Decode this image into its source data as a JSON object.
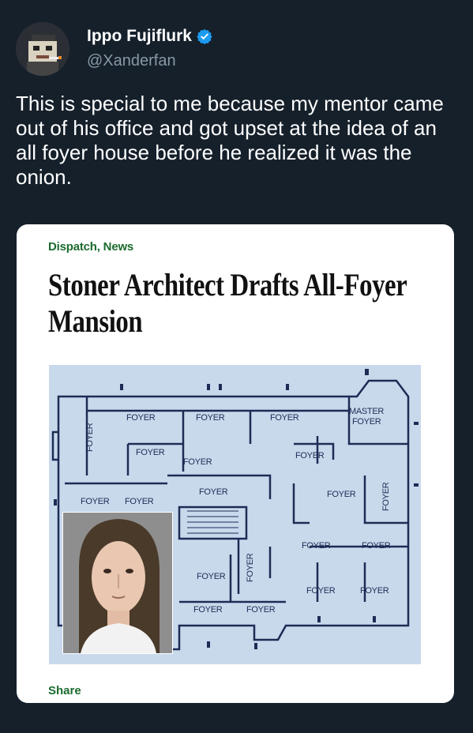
{
  "tweet": {
    "display_name": "Ippo Fujiflurk",
    "handle": "@Xanderfan",
    "text": "This is special to me because my mentor came out of his office and got upset at the idea of an all foyer house before he realized it was the onion.",
    "verified": true
  },
  "card": {
    "category": "Dispatch, News",
    "headline": "Stoner Architect Drafts All-Foyer Mansion",
    "share_label": "Share"
  },
  "floorplan": {
    "labels": [
      "FOYER",
      "FOYER",
      "FOYER",
      "MASTER",
      "FOYER",
      "FOYER",
      "FOYER",
      "FOYER",
      "FOYER",
      "FOYER",
      "FOYER",
      "FOYER",
      "FOYER",
      "FOYER",
      "FOYER",
      "FOYER",
      "FOYER",
      "FOYER",
      "FOYER",
      "FOYER",
      "FOYER",
      "FOYER"
    ]
  },
  "colors": {
    "background": "#15202b",
    "accent": "#1c6b2e",
    "verified": "#1d9bf0",
    "plan_bg": "#c9d9ec",
    "plan_line": "#1c2c55"
  }
}
